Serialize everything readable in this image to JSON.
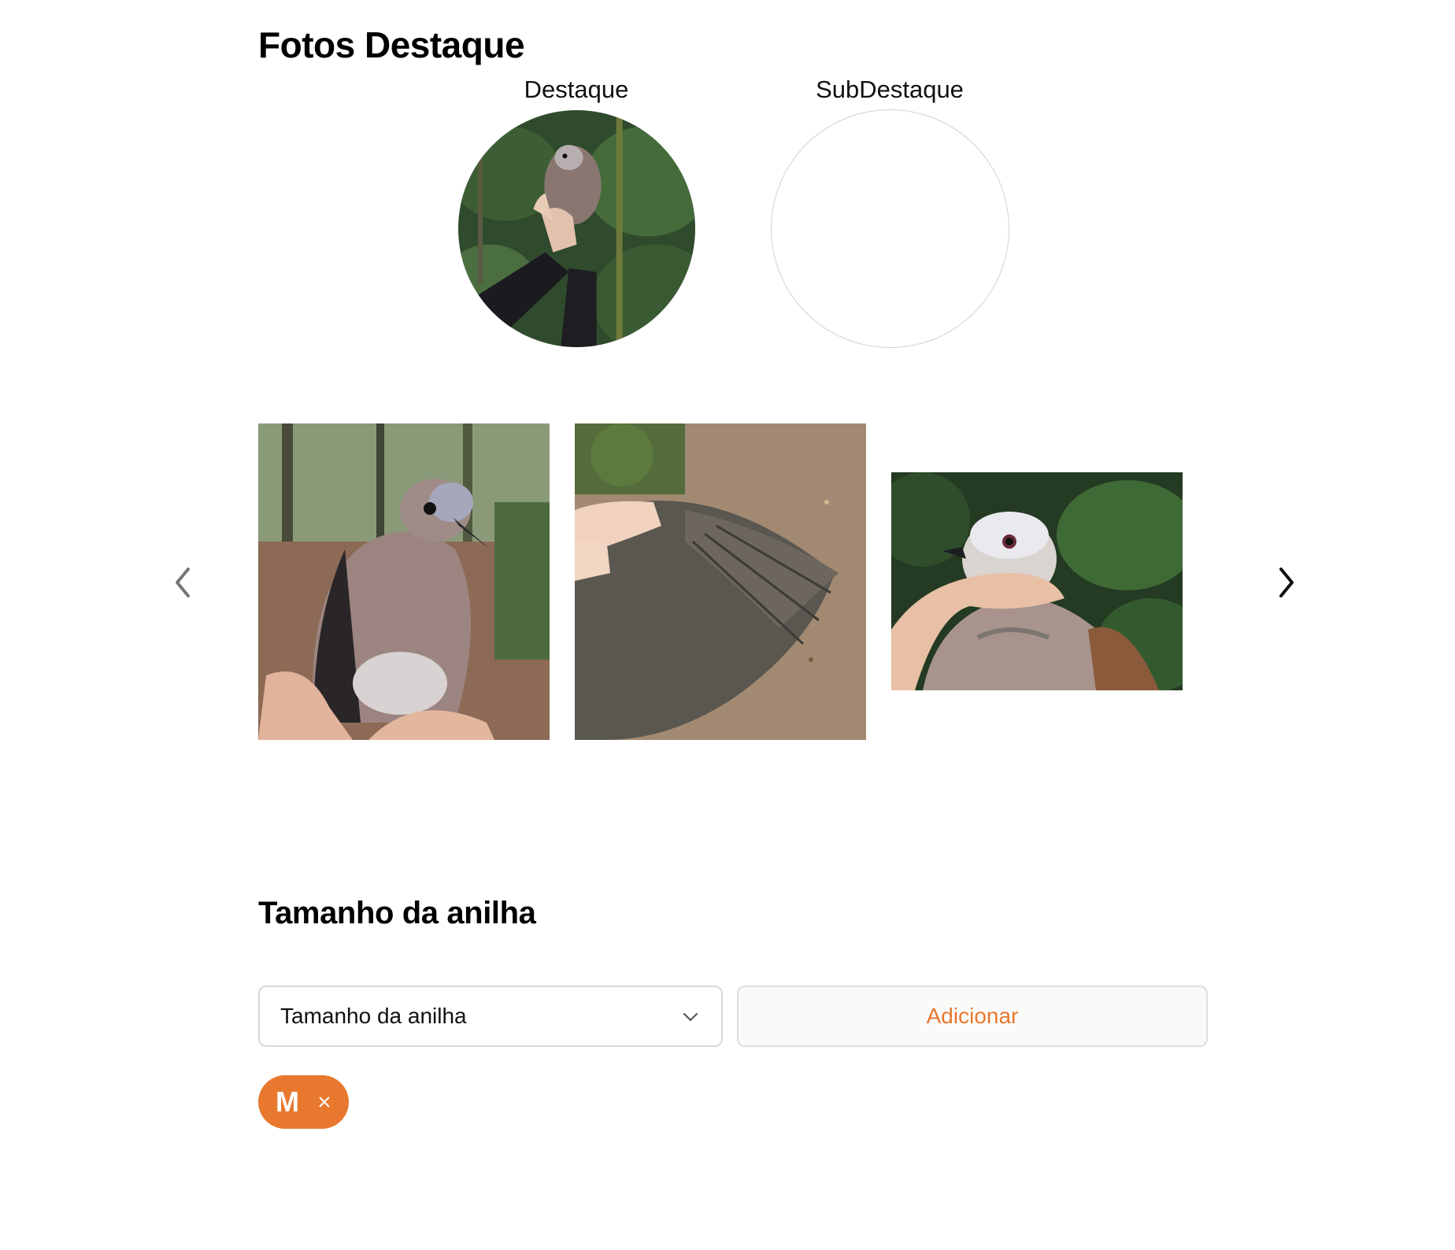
{
  "featured": {
    "title": "Fotos Destaque",
    "main_label": "Destaque",
    "sub_label": "SubDestaque"
  },
  "gallery": {
    "prev_icon": "chevron-left-icon",
    "next_icon": "chevron-right-icon"
  },
  "band_size": {
    "title": "Tamanho da anilha",
    "select_value": "Tamanho da anilha",
    "add_button": "Adicionar",
    "chips": [
      {
        "label": "M"
      }
    ]
  },
  "colors": {
    "accent": "#e8782e",
    "border": "#d9d9d9"
  }
}
